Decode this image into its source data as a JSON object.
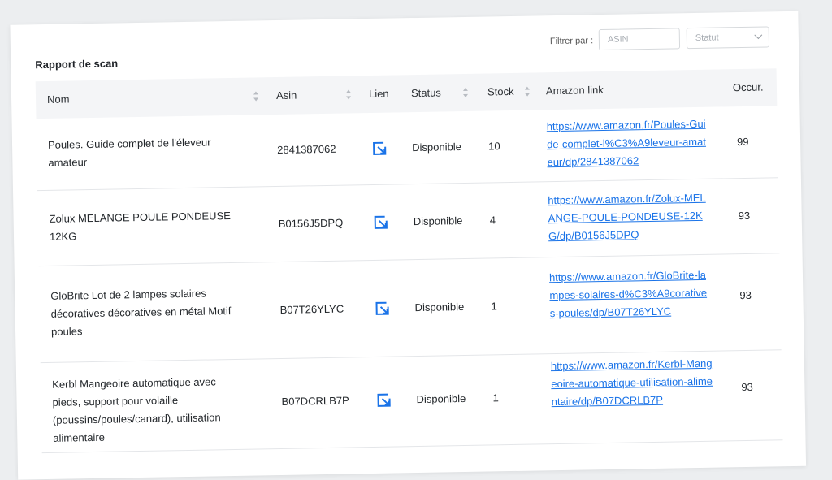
{
  "report": {
    "title": "Rapport de scan"
  },
  "filters": {
    "label": "Filtrer par :",
    "asin_placeholder": "ASIN",
    "status_placeholder": "Statut"
  },
  "columns": {
    "nom": "Nom",
    "asin": "Asin",
    "lien": "Lien",
    "status": "Status",
    "stock": "Stock",
    "amazon": "Amazon link",
    "occur": "Occur."
  },
  "rows": [
    {
      "name": "Poules. Guide complet de l'éleveur amateur",
      "asin": "2841387062",
      "status": "Disponible",
      "stock": "10",
      "amazon_link": "https://www.amazon.fr/Poules-Guide-complet-l%C3%A9leveur-amateur/dp/2841387062",
      "occur": "99"
    },
    {
      "name": "Zolux MELANGE POULE PONDEUSE 12KG",
      "asin": "B0156J5DPQ",
      "status": "Disponible",
      "stock": "4",
      "amazon_link": "https://www.amazon.fr/Zolux-MELANGE-POULE-PONDEUSE-12KG/dp/B0156J5DPQ",
      "occur": "93"
    },
    {
      "name": "GloBrite Lot de 2 lampes solaires décoratives décoratives en métal Motif poules",
      "asin": "B07T26YLYC",
      "status": "Disponible",
      "stock": "1",
      "amazon_link": "https://www.amazon.fr/GloBrite-lampes-solaires-d%C3%A9coratives-poules/dp/B07T26YLYC",
      "occur": "93"
    },
    {
      "name": "Kerbl Mangeoire automatique avec pieds, support pour volaille (poussins/poules/canard), utilisation alimentaire",
      "asin": "B07DCRLB7P",
      "status": "Disponible",
      "stock": "1",
      "amazon_link": "https://www.amazon.fr/Kerbl-Mangeoire-automatique-utilisation-alimentaire/dp/B07DCRLB7P",
      "occur": "93"
    }
  ],
  "colors": {
    "link": "#1a73e8",
    "header_bg": "#f4f5f7",
    "page_bg": "#eceef0"
  },
  "icons": {
    "lien": "external-link-icon",
    "sort": "sort-icon",
    "select": "chevron-down-icon"
  }
}
